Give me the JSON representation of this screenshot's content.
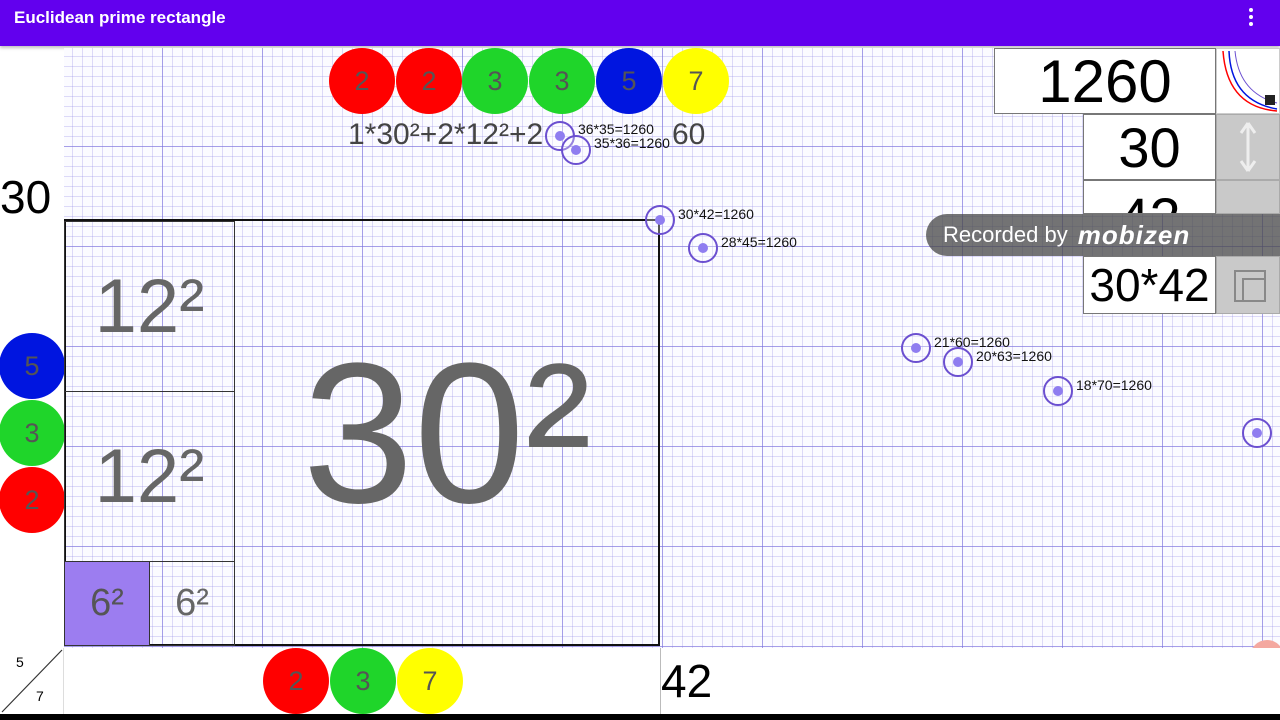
{
  "app": {
    "title": "Euclidean prime rectangle"
  },
  "top_factors": [
    "2",
    "2",
    "3",
    "3",
    "5",
    "7"
  ],
  "left_factors": [
    "5",
    "3",
    "2"
  ],
  "bottom_factors": [
    "2",
    "3",
    "7"
  ],
  "formula": "1*30²+2*12²+2",
  "formula_tail": "60",
  "side_height_label": "30",
  "side_width_label": "42",
  "fraction": {
    "numerator": "5",
    "denominator": "7"
  },
  "squares": {
    "big": "30²",
    "medium_top": "12²",
    "medium_bottom": "12²",
    "small_left": "6²",
    "small_right": "6²"
  },
  "factor_pairs": [
    "36*35=1260",
    "35*36=1260",
    "30*42=1260",
    "28*45=1260",
    "21*60=1260",
    "20*63=1260",
    "18*70=1260"
  ],
  "info_panel": {
    "area": "1260",
    "height": "30",
    "width": "42",
    "product": "30*42"
  },
  "watermark": {
    "text": "Recorded by",
    "brand": "mobizen"
  },
  "colors": {
    "appbar": "#6200ee",
    "factor_2": "#ff0000",
    "factor_3": "#1fd52a",
    "factor_5": "#0015e0",
    "factor_7": "#ffff00",
    "selected_square": "#9c7df0"
  }
}
